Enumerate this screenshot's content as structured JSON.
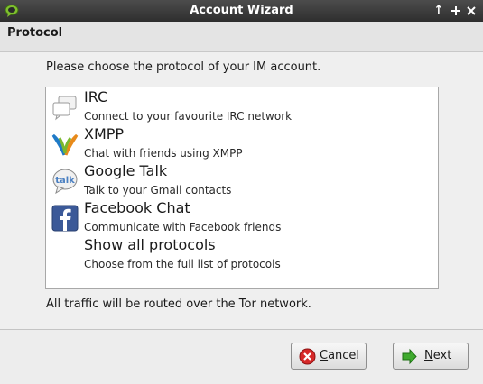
{
  "window": {
    "title": "Account Wizard",
    "controls": [
      "up-arrow-icon",
      "maximize-icon",
      "close-icon"
    ]
  },
  "header": {
    "title": "Protocol"
  },
  "main": {
    "prompt": "Please choose the protocol of your IM account.",
    "protocols": [
      {
        "name": "IRC",
        "description": "Connect to your favourite IRC network",
        "icon": "chat-bubbles-icon"
      },
      {
        "name": "XMPP",
        "description": "Chat with friends using XMPP",
        "icon": "xmpp-icon"
      },
      {
        "name": "Google Talk",
        "description": "Talk to your Gmail contacts",
        "icon": "google-talk-icon"
      },
      {
        "name": "Facebook Chat",
        "description": "Communicate with Facebook friends",
        "icon": "facebook-icon"
      },
      {
        "name": "Show all protocols",
        "description": "Choose from the full list of protocols",
        "icon": ""
      }
    ],
    "footnote": "All traffic will be routed over the Tor network."
  },
  "buttons": {
    "cancel": {
      "label_mnemonic": "C",
      "label_rest": "ancel",
      "icon": "cancel-icon"
    },
    "next": {
      "label_mnemonic": "N",
      "label_rest": "ext",
      "icon": "next-arrow-icon"
    }
  },
  "colors": {
    "titlebar": "#3a3a3a",
    "cancel_red": "#d62828",
    "next_green": "#3faa2e",
    "facebook_blue": "#3b5998"
  }
}
